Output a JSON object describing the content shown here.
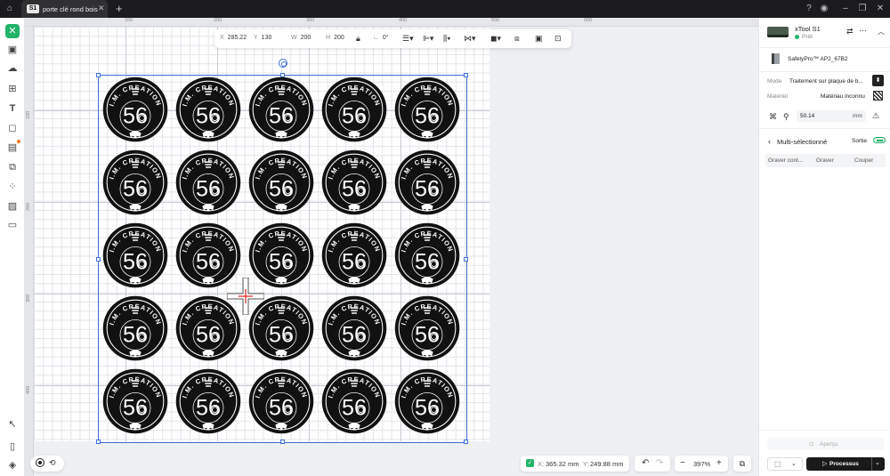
{
  "titlebar": {
    "tab_badge": "S1",
    "tab_title": "porte clé rond bois",
    "tab_close": "✕",
    "new_tab": "+"
  },
  "ruler": {
    "top_ticks": [
      "100",
      "200",
      "300",
      "400",
      "500",
      "600"
    ],
    "left_ticks": [
      "100",
      "200",
      "300",
      "400"
    ]
  },
  "propbar": {
    "x_label": "X",
    "x_value": "285.22",
    "y_label": "Y",
    "y_value": "130",
    "w_label": "W",
    "w_value": "200",
    "h_label": "H",
    "h_value": "200",
    "rotation": "0°"
  },
  "badge": {
    "number": "56",
    "arc_text": "I.M. CREATION",
    "rows": 5,
    "cols": 5
  },
  "status": {
    "x_label": "X:",
    "x_value": "365.32 mm",
    "y_label": "Y:",
    "y_value": "249.88 mm",
    "zoom": "397%"
  },
  "right": {
    "device_name": "xTool S1",
    "device_status": "Prêt",
    "accessory": "SafetyPro™ AP2_67B2",
    "mode_label": "Mode",
    "mode_value": "Traitement sur plaque de b...",
    "material_label": "Matériel",
    "material_value": "Matériau inconnu",
    "thickness_value": "50.14",
    "thickness_unit": "mm",
    "multi_title": "Multi-sélectionné",
    "output_label": "Sortie",
    "process_cols": [
      "Graver cont...",
      "Graver",
      "Couper"
    ],
    "preview_label": "Aperçu",
    "process_button": "Processus"
  },
  "colors": {
    "accent": "#21b36a",
    "selection": "#3d6fd6",
    "badge_fill": "#111111"
  }
}
